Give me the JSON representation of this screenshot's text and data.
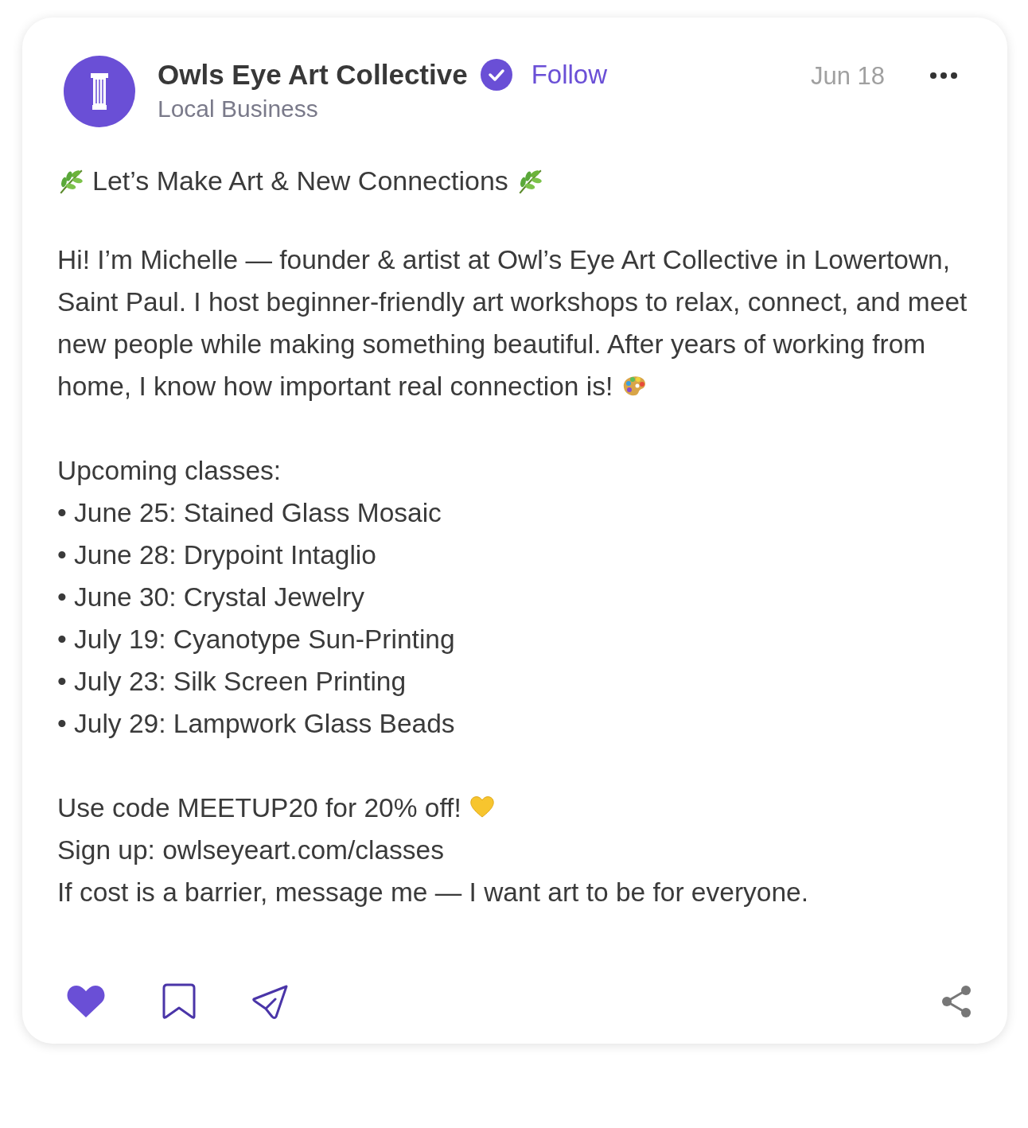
{
  "post": {
    "author": {
      "name": "Owls Eye Art Collective",
      "verified": true,
      "category": "Local Business"
    },
    "follow": "Follow",
    "date": "Jun 18",
    "title": "Let’s Make Art & New Connections",
    "intro": "Hi! I’m Michelle — founder & artist at Owl’s Eye Art Collective in Lowertown, Saint Paul. I host beginner-friendly art workshops to relax, connect, and meet new people while making something beautiful. After years of working from home, I know how important real connection is!",
    "classes_heading": "Upcoming classes:",
    "classes": [
      "• June 25: Stained Glass Mosaic",
      "• June 28: Drypoint Intaglio",
      "• June 30: Crystal Jewelry",
      "• July 19: Cyanotype Sun-Printing",
      "• July 23: Silk Screen Printing",
      "• July 29: Lampwork Glass Beads"
    ],
    "footer_lines": [
      "Use code MEETUP20 for 20% off!",
      "Sign up: owlseyeart.com/classes",
      "If cost is a barrier, message me — I want art to be for everyone."
    ]
  },
  "actions": {
    "liked": true,
    "saved": false
  }
}
